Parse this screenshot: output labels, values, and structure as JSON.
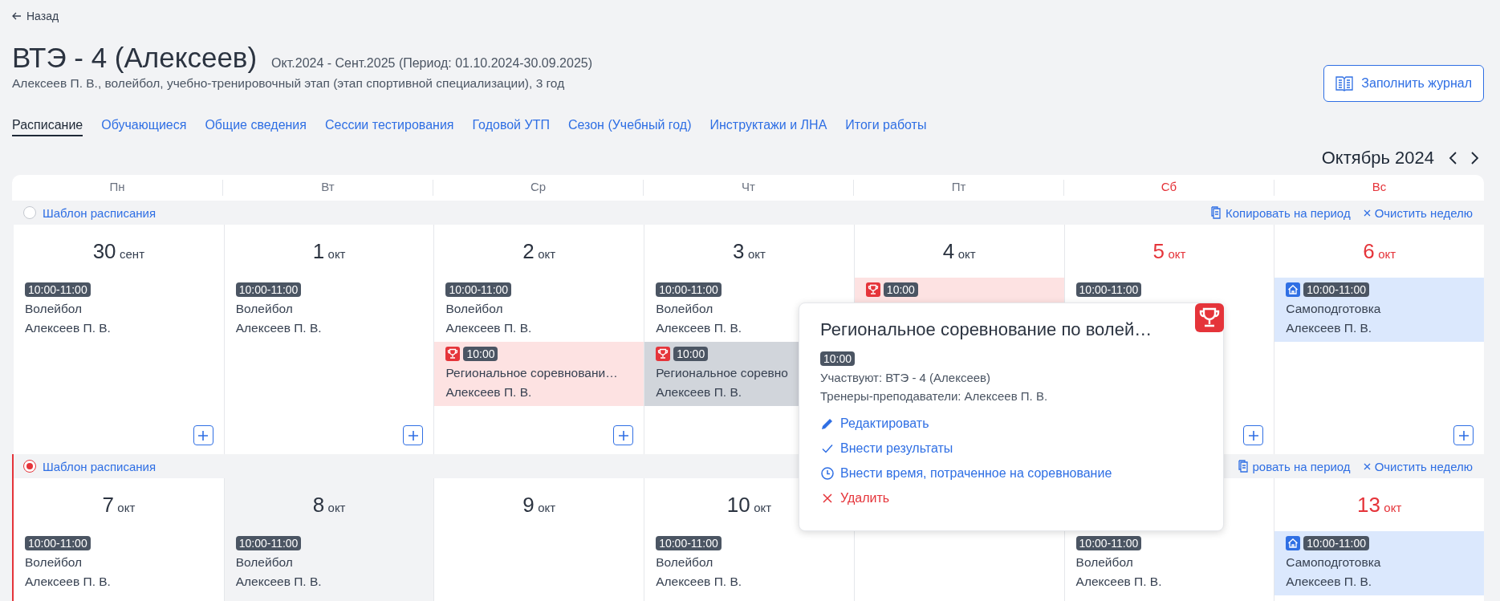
{
  "back_link": "Назад",
  "title": "ВТЭ - 4 (Алексеев)",
  "period": "Окт.2024 - Сент.2025 (Период: 01.10.2024-30.09.2025)",
  "subtitle": "Алексеев П. В., волейбол, учебно-тренировочный этап (этап спортивной специализации), 3 год",
  "fill_journal_button": "Заполнить журнал",
  "tabs": [
    {
      "label": "Расписание",
      "selected": true
    },
    {
      "label": "Обучающиеся",
      "selected": false
    },
    {
      "label": "Общие сведения",
      "selected": false
    },
    {
      "label": "Сессии тестирования",
      "selected": false
    },
    {
      "label": "Годовой УТП",
      "selected": false
    },
    {
      "label": "Сезон (Учебный год)",
      "selected": false
    },
    {
      "label": "Инструктажи и ЛНА",
      "selected": false
    },
    {
      "label": "Итоги работы",
      "selected": false
    }
  ],
  "month": "Октябрь 2024",
  "weekdays": [
    {
      "label": "Пн",
      "weekend": false
    },
    {
      "label": "Вт",
      "weekend": false
    },
    {
      "label": "Ср",
      "weekend": false
    },
    {
      "label": "Чт",
      "weekend": false
    },
    {
      "label": "Пт",
      "weekend": false
    },
    {
      "label": "Сб",
      "weekend": true
    },
    {
      "label": "Вс",
      "weekend": true
    }
  ],
  "weeks": [
    {
      "template_label": "Шаблон расписания",
      "selected": false,
      "copy_action": "Копировать на период",
      "clear_action": "Очистить неделю",
      "days": [
        {
          "day": "30",
          "month": "сент",
          "shaded": false,
          "events": [
            {
              "kind": "training",
              "selected": false,
              "time": "10:00-11:00",
              "title": "Волейбол",
              "person": "Алексеев П. В."
            }
          ]
        },
        {
          "day": "1",
          "month": "окт",
          "shaded": false,
          "events": [
            {
              "kind": "training",
              "selected": false,
              "time": "10:00-11:00",
              "title": "Волейбол",
              "person": "Алексеев П. В."
            }
          ]
        },
        {
          "day": "2",
          "month": "окт",
          "shaded": false,
          "events": [
            {
              "kind": "training",
              "selected": false,
              "time": "10:00-11:00",
              "title": "Волейбол",
              "person": "Алексеев П. В."
            },
            {
              "kind": "competition",
              "selected": false,
              "time": "10:00",
              "title": "Региональное соревновани…",
              "person": "Алексеев П. В."
            }
          ]
        },
        {
          "day": "3",
          "month": "окт",
          "shaded": false,
          "events": [
            {
              "kind": "training",
              "selected": false,
              "time": "10:00-11:00",
              "title": "Волейбол",
              "person": "Алексеев П. В."
            },
            {
              "kind": "competition",
              "selected": true,
              "time": "10:00",
              "title": "Региональное соревно",
              "person": "Алексеев П. В."
            }
          ]
        },
        {
          "day": "4",
          "month": "окт",
          "shaded": false,
          "events": [
            {
              "kind": "competition",
              "selected": false,
              "time": "10:00"
            }
          ]
        },
        {
          "day": "5",
          "month": "окт",
          "shaded": false,
          "events": [
            {
              "kind": "training",
              "selected": false,
              "time": "10:00-11:00"
            }
          ]
        },
        {
          "day": "6",
          "month": "окт",
          "shaded": false,
          "events": [
            {
              "kind": "self",
              "selected": false,
              "time": "10:00-11:00",
              "title": "Самоподготовка",
              "person": "Алексеев П. В."
            }
          ]
        }
      ]
    },
    {
      "template_label": "Шаблон расписания",
      "selected": true,
      "copy_action": "ровать на период",
      "clear_action": "Очистить неделю",
      "days": [
        {
          "day": "7",
          "month": "окт",
          "shaded": false,
          "events": [
            {
              "kind": "training",
              "selected": false,
              "time": "10:00-11:00",
              "title": "Волейбол",
              "person": "Алексеев П. В."
            }
          ]
        },
        {
          "day": "8",
          "month": "окт",
          "shaded": true,
          "events": [
            {
              "kind": "training",
              "selected": false,
              "time": "10:00-11:00",
              "title": "Волейбол",
              "person": "Алексеев П. В."
            }
          ]
        },
        {
          "day": "9",
          "month": "окт",
          "shaded": false
        },
        {
          "day": "10",
          "month": "окт",
          "shaded": false,
          "events": [
            {
              "kind": "training",
              "selected": false,
              "time": "10:00-11:00",
              "title": "Волейбол",
              "person": "Алексеев П. В."
            }
          ]
        },
        {
          "shaded": false
        },
        {
          "shaded": false,
          "events": [
            {
              "kind": "training",
              "selected": false,
              "time": "10:00-11:00",
              "title": "Волейбол",
              "person": "Алексеев П. В."
            }
          ]
        },
        {
          "day": "13",
          "month": "окт",
          "shaded": false,
          "events": [
            {
              "kind": "self",
              "selected": false,
              "time": "10:00-11:00",
              "title": "Самоподготовка",
              "person": "Алексеев П. В."
            }
          ]
        }
      ]
    }
  ],
  "popover": {
    "title": "Региональное соревнование по волей…",
    "time": "10:00",
    "participants": "Участвуют: ВТЭ - 4 (Алексеев)",
    "coaches": "Тренеры-преподаватели: Алексеев П. В.",
    "actions": [
      {
        "kind": "edit",
        "label": "Редактировать"
      },
      {
        "kind": "results",
        "label": "Внести результаты"
      },
      {
        "kind": "time",
        "label": "Внести время, потраченное на соревнование"
      },
      {
        "kind": "delete",
        "label": "Удалить"
      }
    ]
  }
}
